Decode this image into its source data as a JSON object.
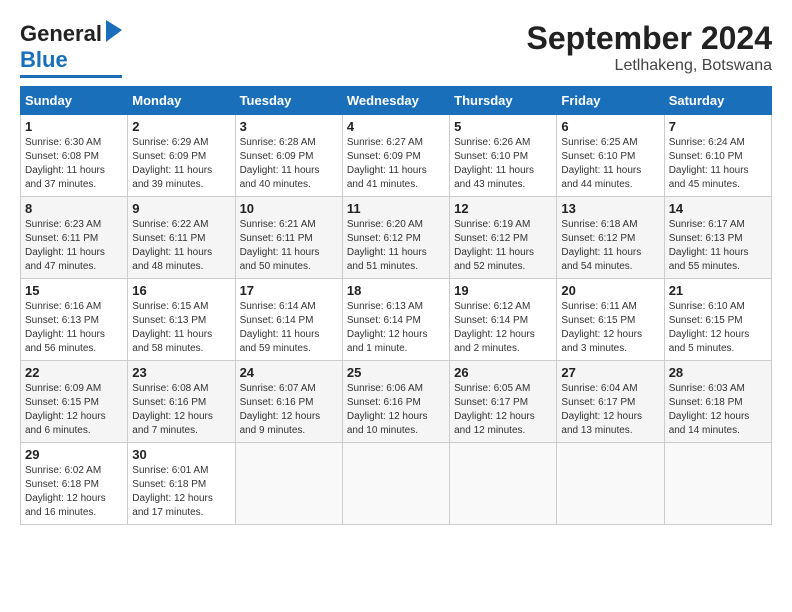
{
  "logo": {
    "line1": "General",
    "line2": "Blue"
  },
  "title": "September 2024",
  "subtitle": "Letlhakeng, Botswana",
  "days_of_week": [
    "Sunday",
    "Monday",
    "Tuesday",
    "Wednesday",
    "Thursday",
    "Friday",
    "Saturday"
  ],
  "weeks": [
    [
      {
        "day": "1",
        "sunrise": "6:30 AM",
        "sunset": "6:08 PM",
        "daylight": "11 hours and 37 minutes."
      },
      {
        "day": "2",
        "sunrise": "6:29 AM",
        "sunset": "6:09 PM",
        "daylight": "11 hours and 39 minutes."
      },
      {
        "day": "3",
        "sunrise": "6:28 AM",
        "sunset": "6:09 PM",
        "daylight": "11 hours and 40 minutes."
      },
      {
        "day": "4",
        "sunrise": "6:27 AM",
        "sunset": "6:09 PM",
        "daylight": "11 hours and 41 minutes."
      },
      {
        "day": "5",
        "sunrise": "6:26 AM",
        "sunset": "6:10 PM",
        "daylight": "11 hours and 43 minutes."
      },
      {
        "day": "6",
        "sunrise": "6:25 AM",
        "sunset": "6:10 PM",
        "daylight": "11 hours and 44 minutes."
      },
      {
        "day": "7",
        "sunrise": "6:24 AM",
        "sunset": "6:10 PM",
        "daylight": "11 hours and 45 minutes."
      }
    ],
    [
      {
        "day": "8",
        "sunrise": "6:23 AM",
        "sunset": "6:11 PM",
        "daylight": "11 hours and 47 minutes."
      },
      {
        "day": "9",
        "sunrise": "6:22 AM",
        "sunset": "6:11 PM",
        "daylight": "11 hours and 48 minutes."
      },
      {
        "day": "10",
        "sunrise": "6:21 AM",
        "sunset": "6:11 PM",
        "daylight": "11 hours and 50 minutes."
      },
      {
        "day": "11",
        "sunrise": "6:20 AM",
        "sunset": "6:12 PM",
        "daylight": "11 hours and 51 minutes."
      },
      {
        "day": "12",
        "sunrise": "6:19 AM",
        "sunset": "6:12 PM",
        "daylight": "11 hours and 52 minutes."
      },
      {
        "day": "13",
        "sunrise": "6:18 AM",
        "sunset": "6:12 PM",
        "daylight": "11 hours and 54 minutes."
      },
      {
        "day": "14",
        "sunrise": "6:17 AM",
        "sunset": "6:13 PM",
        "daylight": "11 hours and 55 minutes."
      }
    ],
    [
      {
        "day": "15",
        "sunrise": "6:16 AM",
        "sunset": "6:13 PM",
        "daylight": "11 hours and 56 minutes."
      },
      {
        "day": "16",
        "sunrise": "6:15 AM",
        "sunset": "6:13 PM",
        "daylight": "11 hours and 58 minutes."
      },
      {
        "day": "17",
        "sunrise": "6:14 AM",
        "sunset": "6:14 PM",
        "daylight": "11 hours and 59 minutes."
      },
      {
        "day": "18",
        "sunrise": "6:13 AM",
        "sunset": "6:14 PM",
        "daylight": "12 hours and 1 minute."
      },
      {
        "day": "19",
        "sunrise": "6:12 AM",
        "sunset": "6:14 PM",
        "daylight": "12 hours and 2 minutes."
      },
      {
        "day": "20",
        "sunrise": "6:11 AM",
        "sunset": "6:15 PM",
        "daylight": "12 hours and 3 minutes."
      },
      {
        "day": "21",
        "sunrise": "6:10 AM",
        "sunset": "6:15 PM",
        "daylight": "12 hours and 5 minutes."
      }
    ],
    [
      {
        "day": "22",
        "sunrise": "6:09 AM",
        "sunset": "6:15 PM",
        "daylight": "12 hours and 6 minutes."
      },
      {
        "day": "23",
        "sunrise": "6:08 AM",
        "sunset": "6:16 PM",
        "daylight": "12 hours and 7 minutes."
      },
      {
        "day": "24",
        "sunrise": "6:07 AM",
        "sunset": "6:16 PM",
        "daylight": "12 hours and 9 minutes."
      },
      {
        "day": "25",
        "sunrise": "6:06 AM",
        "sunset": "6:16 PM",
        "daylight": "12 hours and 10 minutes."
      },
      {
        "day": "26",
        "sunrise": "6:05 AM",
        "sunset": "6:17 PM",
        "daylight": "12 hours and 12 minutes."
      },
      {
        "day": "27",
        "sunrise": "6:04 AM",
        "sunset": "6:17 PM",
        "daylight": "12 hours and 13 minutes."
      },
      {
        "day": "28",
        "sunrise": "6:03 AM",
        "sunset": "6:18 PM",
        "daylight": "12 hours and 14 minutes."
      }
    ],
    [
      {
        "day": "29",
        "sunrise": "6:02 AM",
        "sunset": "6:18 PM",
        "daylight": "12 hours and 16 minutes."
      },
      {
        "day": "30",
        "sunrise": "6:01 AM",
        "sunset": "6:18 PM",
        "daylight": "12 hours and 17 minutes."
      },
      null,
      null,
      null,
      null,
      null
    ]
  ]
}
